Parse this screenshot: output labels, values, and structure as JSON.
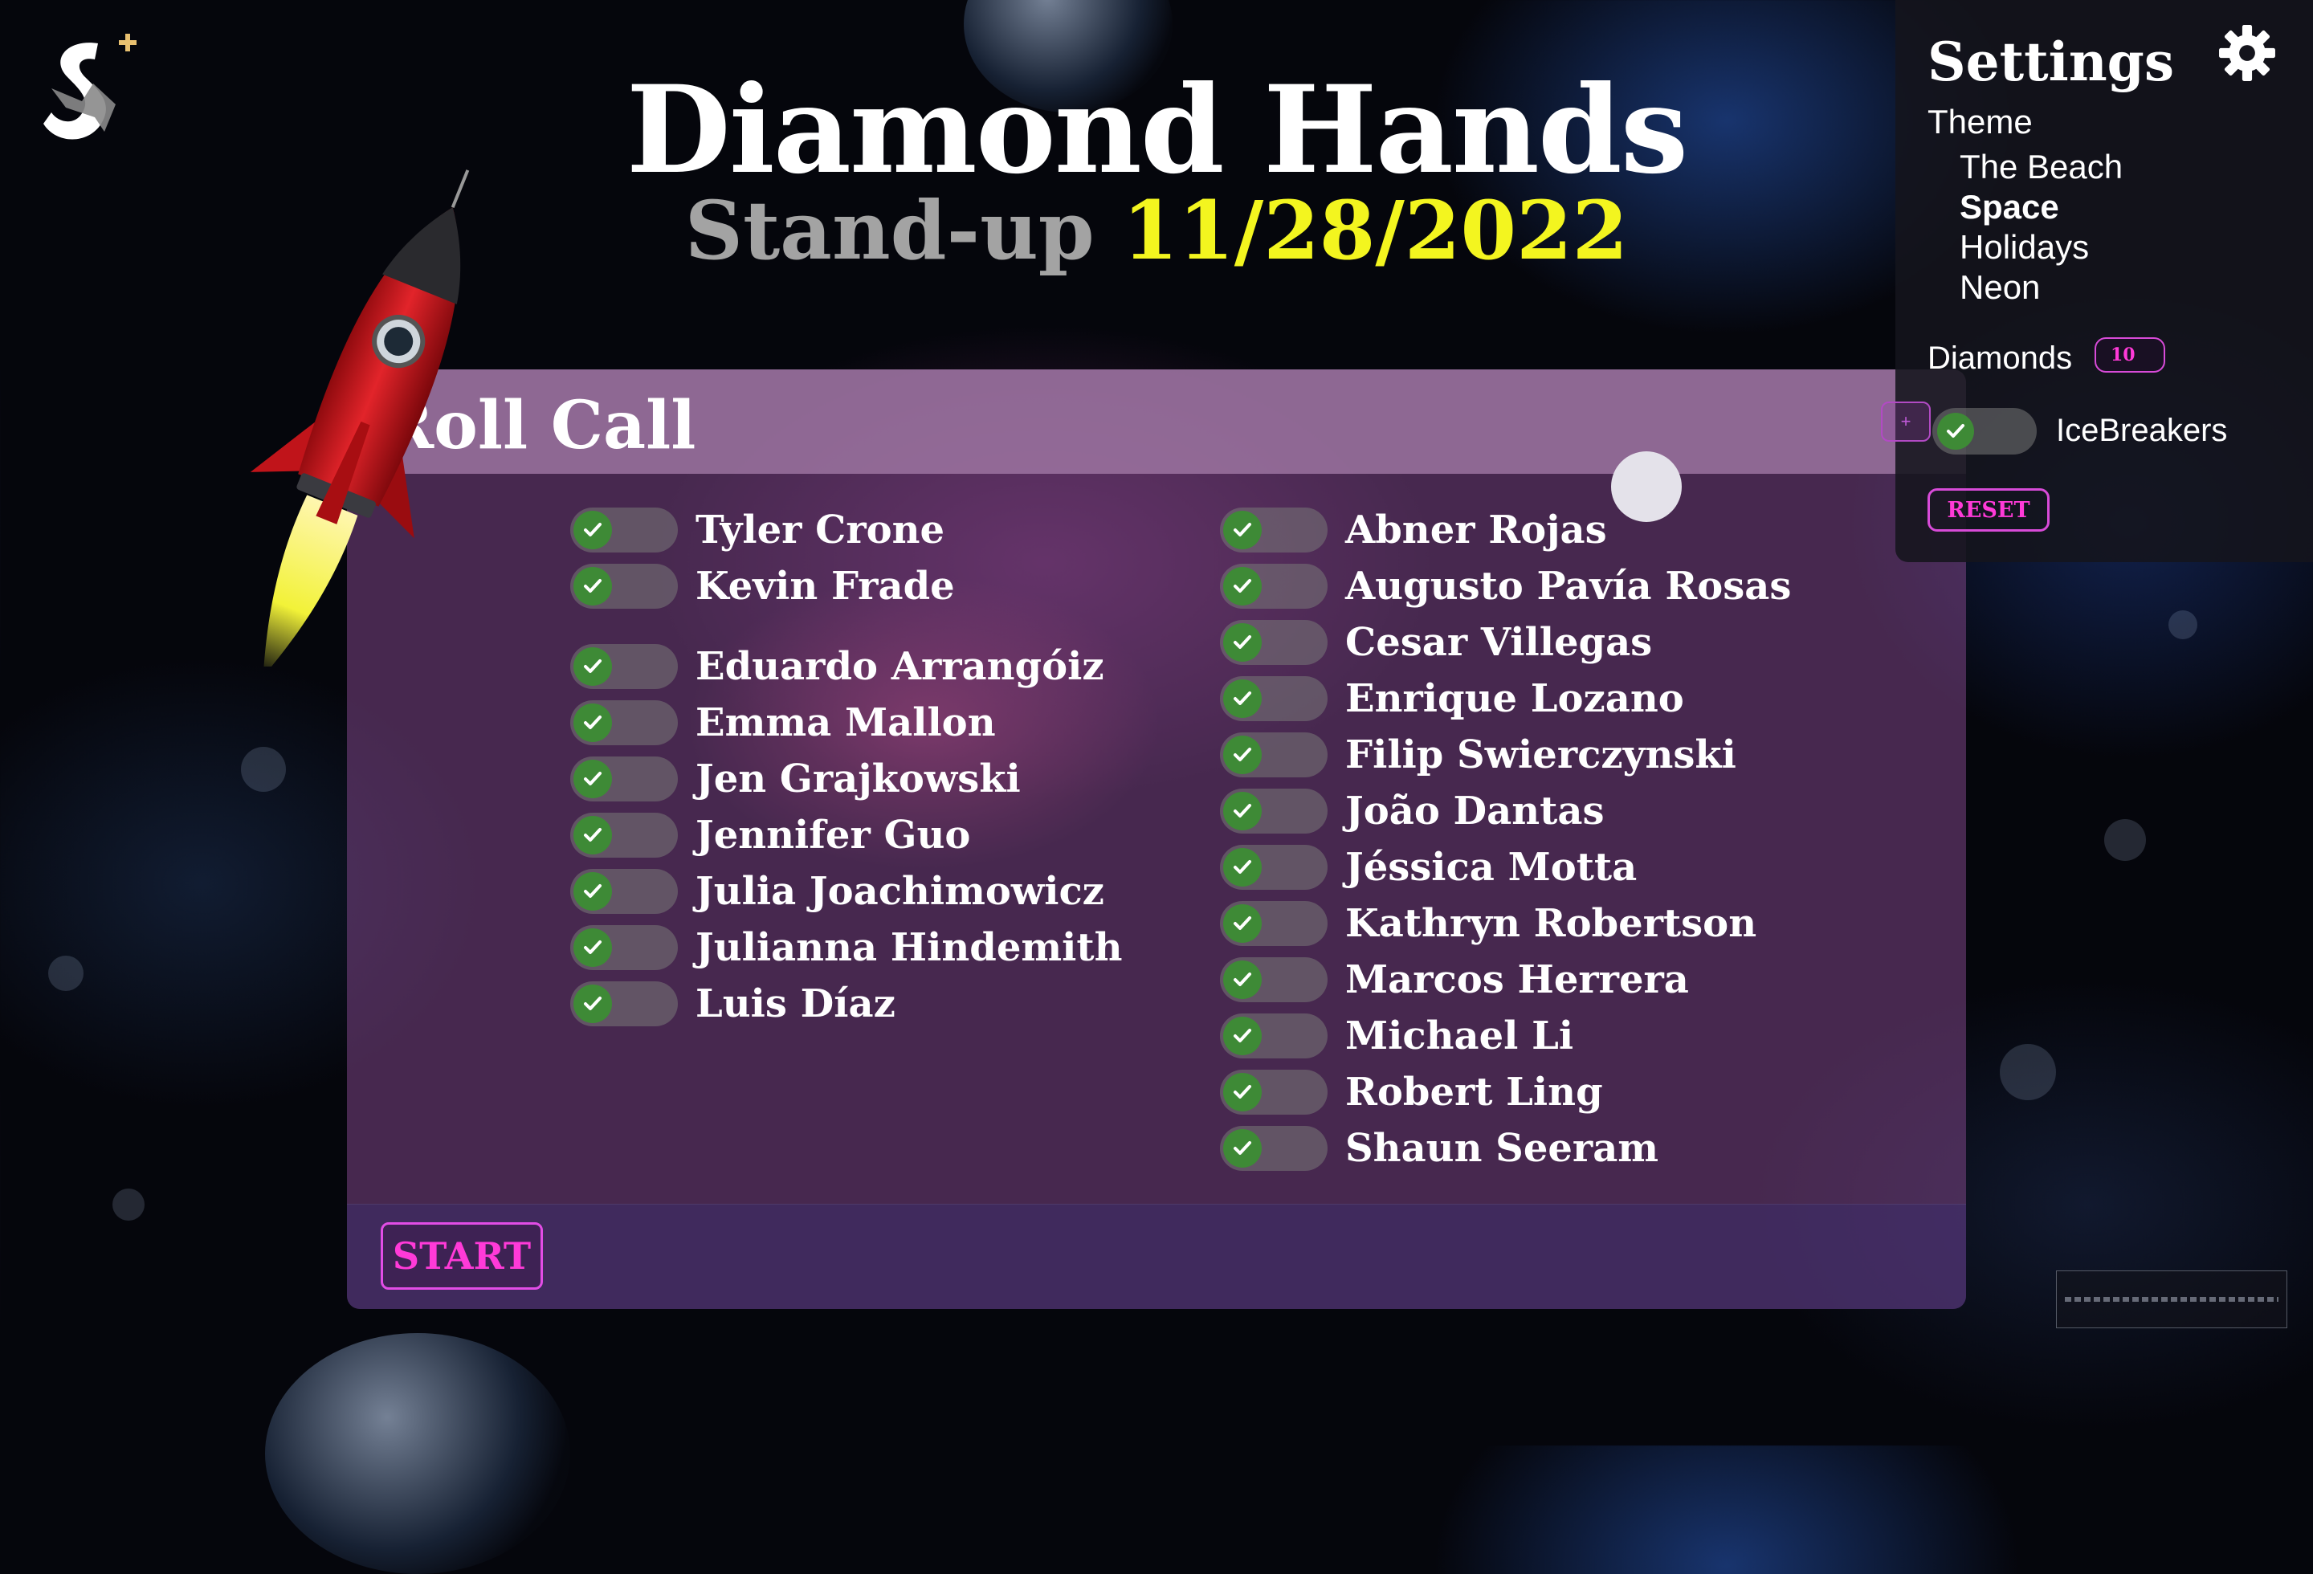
{
  "app": {
    "title": "Diamond Hands",
    "subtitle_label": "Stand-up",
    "subtitle_date": "11/28/2022"
  },
  "roll_call": {
    "title": "Roll Call",
    "start_label": "START",
    "column_left": [
      {
        "name": "Tyler Crone",
        "checked": true
      },
      {
        "name": "Kevin Frade",
        "checked": true
      },
      {
        "name": "Eduardo Arrangóiz",
        "checked": true
      },
      {
        "name": "Emma Mallon",
        "checked": true
      },
      {
        "name": "Jen Grajkowski",
        "checked": true
      },
      {
        "name": "Jennifer Guo",
        "checked": true
      },
      {
        "name": "Julia Joachimowicz",
        "checked": true
      },
      {
        "name": "Julianna Hindemith",
        "checked": true
      },
      {
        "name": "Luis Díaz",
        "checked": true
      }
    ],
    "column_right": [
      {
        "name": "Abner Rojas",
        "checked": true
      },
      {
        "name": "Augusto Pavía Rosas",
        "checked": true
      },
      {
        "name": "Cesar Villegas",
        "checked": true
      },
      {
        "name": "Enrique Lozano",
        "checked": true
      },
      {
        "name": "Filip Swierczynski",
        "checked": true
      },
      {
        "name": "João Dantas",
        "checked": true
      },
      {
        "name": "Jéssica Motta",
        "checked": true
      },
      {
        "name": "Kathryn Robertson",
        "checked": true
      },
      {
        "name": "Marcos Herrera",
        "checked": true
      },
      {
        "name": "Michael Li",
        "checked": true
      },
      {
        "name": "Robert Ling",
        "checked": true
      },
      {
        "name": "Shaun Seeram",
        "checked": true
      }
    ]
  },
  "settings": {
    "title": "Settings",
    "theme_label": "Theme",
    "themes": [
      "The Beach",
      "Space",
      "Holidays",
      "Neon"
    ],
    "active_theme": "Space",
    "diamonds_label": "Diamonds",
    "diamonds_value": "10",
    "icebreakers_label": "IceBreakers",
    "icebreakers_enabled": true,
    "reset_label": "RESET",
    "mini_button_label": "+"
  },
  "colors": {
    "accent_magenta": "#ff3ad8",
    "date_yellow": "#f3f51f",
    "toggle_green": "#3e8a36"
  },
  "icons": {
    "logo": "app-logo-icon",
    "settings": "gear-icon",
    "check": "check-icon",
    "rocket": "rocket-image"
  }
}
